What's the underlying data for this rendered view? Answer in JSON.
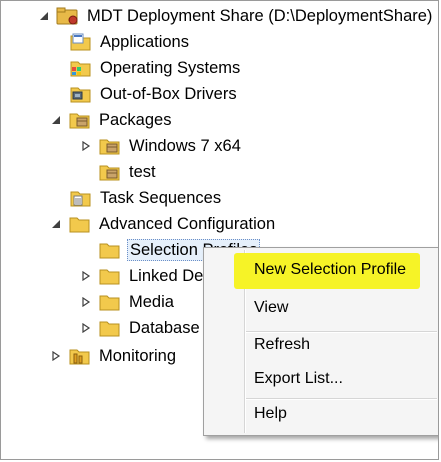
{
  "tree": {
    "root": "MDT Deployment Share (D:\\DeploymentShare)",
    "applications": "Applications",
    "operating_systems": "Operating Systems",
    "drivers": "Out-of-Box Drivers",
    "packages": "Packages",
    "win7": "Windows 7 x64",
    "test": "test",
    "task_sequences": "Task Sequences",
    "advanced": "Advanced Configuration",
    "selection_profiles": "Selection Profiles",
    "linked": "Linked Deployment Shares",
    "media": "Media",
    "database": "Database",
    "monitoring": "Monitoring"
  },
  "context_menu": {
    "new_selection_profile": "New Selection Profile",
    "view": "View",
    "refresh": "Refresh",
    "export_list": "Export List...",
    "help": "Help"
  },
  "colors": {
    "highlight": "#f6f327",
    "folder": "#f2c94c",
    "menu_bg": "#f5f5f5"
  }
}
